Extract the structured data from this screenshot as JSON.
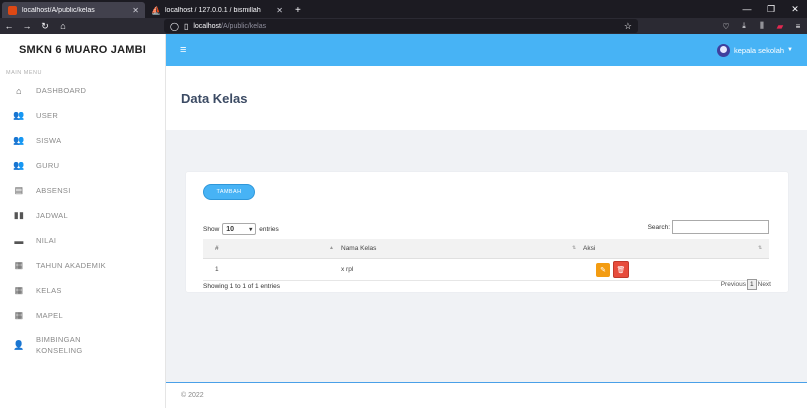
{
  "browser": {
    "tabs": [
      {
        "title": "localhost/A/public/kelas",
        "active": true,
        "favicon": "codeigniter-icon"
      },
      {
        "title": "localhost / 127.0.0.1 / bismillah",
        "active": false,
        "favicon": "phpmyadmin-icon"
      }
    ],
    "url_host": "localhost",
    "url_path": "/A/public/kelas"
  },
  "app": {
    "brand": "SMKN 6 MUARO JAMBI",
    "menu_heading": "MAIN MENU",
    "menu": [
      {
        "label": "DASHBOARD",
        "icon": "home-icon"
      },
      {
        "label": "USER",
        "icon": "users-icon"
      },
      {
        "label": "SISWA",
        "icon": "users-icon"
      },
      {
        "label": "GURU",
        "icon": "users-icon"
      },
      {
        "label": "ABSENSI",
        "icon": "clipboard-icon"
      },
      {
        "label": "JADWAL",
        "icon": "book-icon"
      },
      {
        "label": "NILAI",
        "icon": "list-icon"
      },
      {
        "label": "TAHUN AKADEMIK",
        "icon": "calendar-icon"
      },
      {
        "label": "KELAS",
        "icon": "calendar-icon"
      },
      {
        "label": "MAPEL",
        "icon": "calendar-icon"
      },
      {
        "label": "BIMBINGAN\nKONSELING",
        "icon": "user-tie-icon"
      }
    ],
    "user_name": "kepala sekolah",
    "page_title": "Data Kelas",
    "add_button": "TAMBAH",
    "show_label": "Show",
    "entries_value": "10",
    "entries_label": "entries",
    "search_label": "Search:",
    "search_value": "",
    "columns": [
      "#",
      "Nama Kelas",
      "Aksi"
    ],
    "rows": [
      {
        "no": "1",
        "nama_kelas": "x rpl"
      }
    ],
    "info": "Showing 1 to 1 of 1 entries",
    "pager": {
      "previous": "Previous",
      "current": "1",
      "next": "Next"
    },
    "footer": "© 2022"
  },
  "colors": {
    "topbar": "#47b3f5",
    "edit": "#f39c12",
    "delete": "#e74c3c"
  }
}
